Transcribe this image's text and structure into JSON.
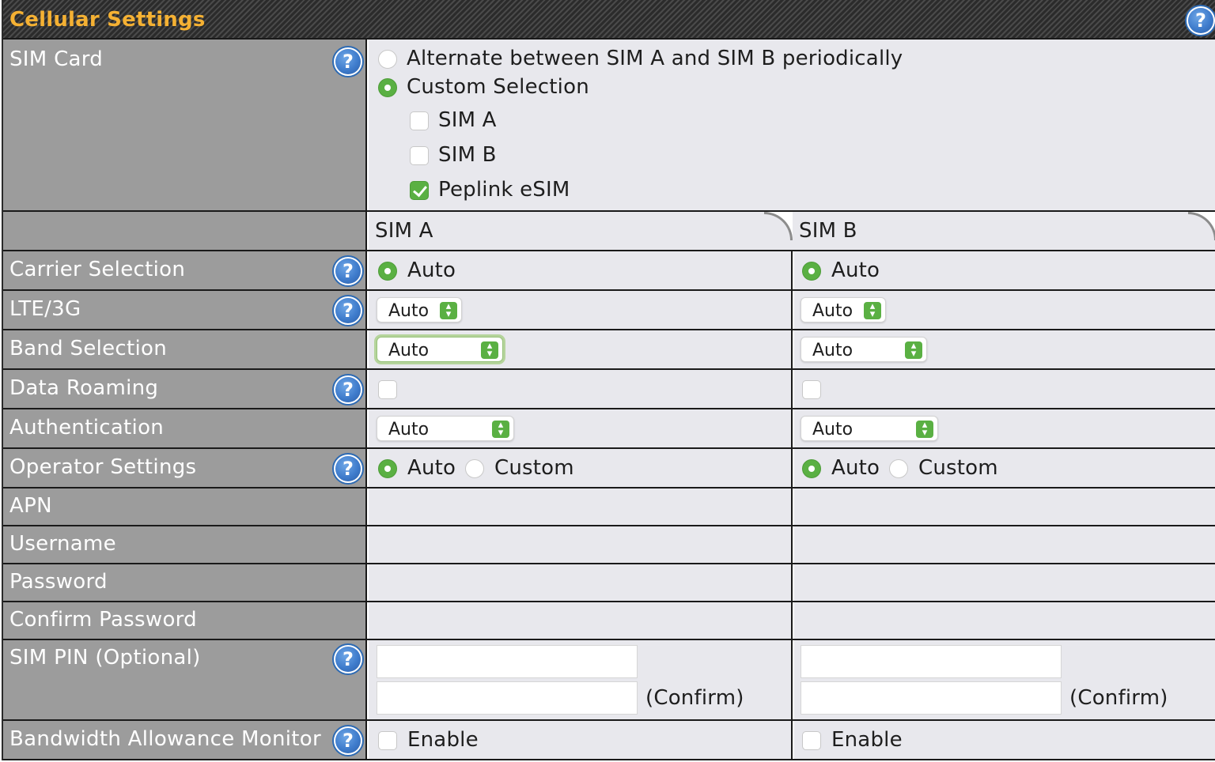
{
  "section": {
    "title": "Cellular Settings"
  },
  "sim_card": {
    "label": "SIM Card",
    "options": [
      "Alternate between SIM A and SIM B periodically",
      "Custom Selection"
    ],
    "selected_option": "Custom Selection",
    "custom": [
      {
        "label": "SIM A",
        "checked": false
      },
      {
        "label": "SIM B",
        "checked": false
      },
      {
        "label": "Peplink eSIM",
        "checked": true
      }
    ]
  },
  "columns": {
    "sim_a": "SIM A",
    "sim_b": "SIM B"
  },
  "rows": {
    "carrier_selection": {
      "label": "Carrier Selection",
      "sim_a": "Auto",
      "sim_b": "Auto"
    },
    "lte_3g": {
      "label": "LTE/3G",
      "sim_a": "Auto",
      "sim_b": "Auto"
    },
    "band_selection": {
      "label": "Band Selection",
      "sim_a": "Auto",
      "sim_b": "Auto"
    },
    "data_roaming": {
      "label": "Data Roaming",
      "sim_a_checked": false,
      "sim_b_checked": false
    },
    "authentication": {
      "label": "Authentication",
      "sim_a": "Auto",
      "sim_b": "Auto"
    },
    "operator_settings": {
      "label": "Operator Settings",
      "option_auto": "Auto",
      "option_custom": "Custom",
      "sim_a_selected": "Auto",
      "sim_b_selected": "Auto"
    },
    "apn": {
      "label": "APN"
    },
    "username": {
      "label": "Username"
    },
    "password": {
      "label": "Password"
    },
    "confirm_password": {
      "label": "Confirm Password"
    },
    "sim_pin": {
      "label": "SIM PIN (Optional)",
      "confirm_label": "(Confirm)",
      "sim_a_value": "",
      "sim_b_value": ""
    },
    "bandwidth_monitor": {
      "label": "Bandwidth Allowance Monitor",
      "enable_label": "Enable",
      "sim_a_checked": false,
      "sim_b_checked": false
    }
  },
  "colors": {
    "accent": "#5ab043",
    "title": "#f5b133",
    "label_bg": "#9c9c9c",
    "value_bg": "#e8e8ed",
    "help": "#3f7ccc"
  },
  "icons": {
    "help": "question-mark-icon",
    "select": "up-down-arrows-icon"
  }
}
